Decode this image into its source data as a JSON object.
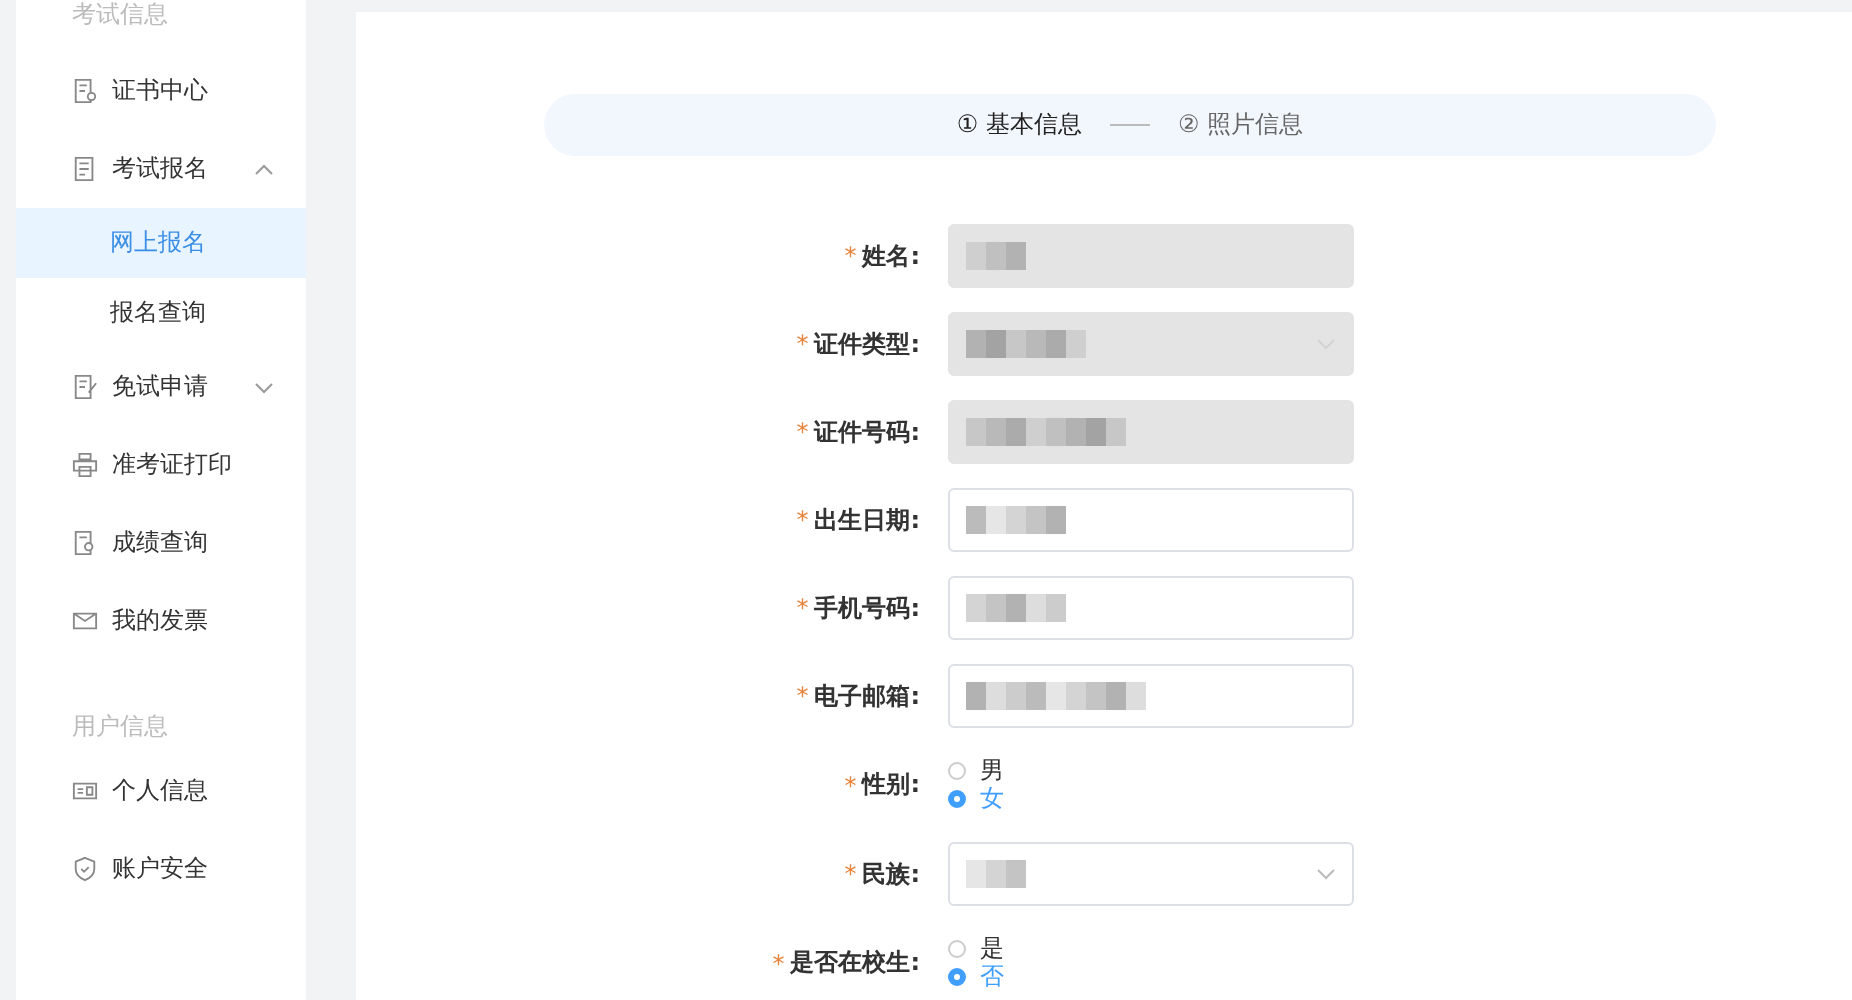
{
  "sidebar": {
    "sections": [
      {
        "title": "考试信息",
        "items": [
          {
            "label": "证书中心",
            "selected": false
          },
          {
            "label": "考试报名",
            "selected": false,
            "expanded": true,
            "children": [
              {
                "label": "网上报名",
                "selected": true
              },
              {
                "label": "报名查询",
                "selected": false
              }
            ]
          },
          {
            "label": "免试申请",
            "selected": false,
            "expanded": false
          },
          {
            "label": "准考证打印",
            "selected": false
          },
          {
            "label": "成绩查询",
            "selected": false
          },
          {
            "label": "我的发票",
            "selected": false
          }
        ]
      },
      {
        "title": "用户信息",
        "items": [
          {
            "label": "个人信息",
            "selected": false
          },
          {
            "label": "账户安全",
            "selected": false
          }
        ]
      }
    ]
  },
  "steps": [
    {
      "number": "①",
      "label": "基本信息",
      "selected": true
    },
    {
      "number": "②",
      "label": "照片信息",
      "selected": false
    }
  ],
  "form": {
    "fields": [
      {
        "kind": "input",
        "label": "姓名:",
        "required_mark": "*",
        "disabled": true,
        "redacted": true
      },
      {
        "kind": "select",
        "label": "证件类型:",
        "required_mark": "*",
        "disabled": true,
        "redacted": true
      },
      {
        "kind": "input",
        "label": "证件号码:",
        "required_mark": "*",
        "disabled": true,
        "redacted": true
      },
      {
        "kind": "input",
        "label": "出生日期:",
        "required_mark": "*",
        "disabled": false,
        "redacted": true
      },
      {
        "kind": "input",
        "label": "手机号码:",
        "required_mark": "*",
        "disabled": false,
        "redacted": true
      },
      {
        "kind": "input",
        "label": "电子邮箱:",
        "required_mark": "*",
        "disabled": false,
        "redacted": true
      },
      {
        "kind": "radio",
        "label": "性别:",
        "required_mark": "*",
        "options": [
          {
            "label": "男",
            "selected": false
          },
          {
            "label": "女",
            "selected": true
          }
        ]
      },
      {
        "kind": "select",
        "label": "民族:",
        "required_mark": "*",
        "disabled": false,
        "redacted": true
      },
      {
        "kind": "radio",
        "label": "是否在校生:",
        "required_mark": "*",
        "options": [
          {
            "label": "是",
            "selected": false
          },
          {
            "label": "否",
            "selected": true
          }
        ]
      }
    ]
  }
}
